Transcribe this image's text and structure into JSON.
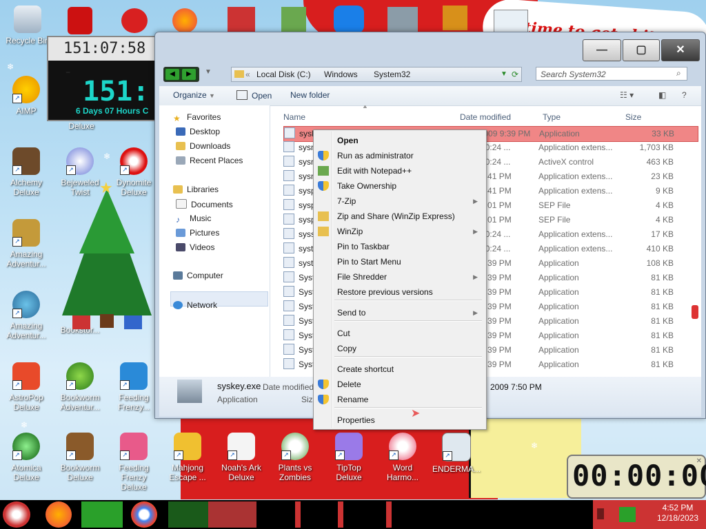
{
  "window": {
    "address": {
      "part1": "Local Disk (C:)",
      "part2": "Windows",
      "part3": "System32"
    },
    "search_placeholder": "Search System32",
    "toolbar": {
      "organize": "Organize",
      "open": "Open",
      "new_folder": "New folder"
    },
    "nav": [
      {
        "label": "Favorites",
        "icon": "star-icon"
      },
      {
        "label": "Desktop",
        "icon": "desktop-icon"
      },
      {
        "label": "Downloads",
        "icon": "downloads-icon"
      },
      {
        "label": "Recent Places",
        "icon": "recent-places-icon"
      },
      {
        "label": "Libraries",
        "icon": "libraries-icon"
      },
      {
        "label": "Documents",
        "icon": "documents-icon"
      },
      {
        "label": "Music",
        "icon": "music-icon"
      },
      {
        "label": "Pictures",
        "icon": "pictures-icon"
      },
      {
        "label": "Videos",
        "icon": "videos-icon"
      },
      {
        "label": "Computer",
        "icon": "computer-icon"
      },
      {
        "label": "Network",
        "icon": "network-icon"
      }
    ],
    "columns": {
      "name": "Name",
      "date": "Date modified",
      "type": "Type",
      "size": "Size"
    },
    "files": [
      {
        "name": "syskey.exe",
        "date": "7/13/2009 9:39 PM",
        "type": "Application",
        "size": "33 KB"
      },
      {
        "name": "sysm",
        "date": "2010 10:24 ...",
        "type": "Application extens...",
        "size": "1,703 KB"
      },
      {
        "name": "sysm",
        "date": "2010 10:24 ...",
        "type": "ActiveX control",
        "size": "463 KB"
      },
      {
        "name": "sysn",
        "date": "2009 9:41 PM",
        "type": "Application extens...",
        "size": "23 KB"
      },
      {
        "name": "sysp",
        "date": "2009 9:41 PM",
        "type": "Application extens...",
        "size": "9 KB"
      },
      {
        "name": "sysp",
        "date": "2009 5:01 PM",
        "type": "SEP File",
        "size": "4 KB"
      },
      {
        "name": "sysp",
        "date": "2009 5:01 PM",
        "type": "SEP File",
        "size": "4 KB"
      },
      {
        "name": "syss",
        "date": "2010 10:24 ...",
        "type": "Application extens...",
        "size": "17 KB"
      },
      {
        "name": "syst",
        "date": "2010 10:24 ...",
        "type": "Application extens...",
        "size": "410 KB"
      },
      {
        "name": "syst",
        "date": "2009 9:39 PM",
        "type": "Application",
        "size": "108 KB"
      },
      {
        "name": "Syst",
        "date": "2009 9:39 PM",
        "type": "Application",
        "size": "81 KB"
      },
      {
        "name": "Syst",
        "date": "2009 9:39 PM",
        "type": "Application",
        "size": "81 KB"
      },
      {
        "name": "Syst",
        "date": "2009 9:39 PM",
        "type": "Application",
        "size": "81 KB"
      },
      {
        "name": "Syst",
        "date": "2009 9:39 PM",
        "type": "Application",
        "size": "81 KB"
      },
      {
        "name": "Syst",
        "date": "2009 9:39 PM",
        "type": "Application",
        "size": "81 KB"
      },
      {
        "name": "Syst",
        "date": "2009 9:39 PM",
        "type": "Application",
        "size": "81 KB"
      },
      {
        "name": "Syst",
        "date": "2009 9:39 PM",
        "type": "Application",
        "size": "81 KB"
      }
    ],
    "details": {
      "filename": "syskey.exe",
      "filetype": "Application",
      "date_label": "Date modified",
      "size_label": "Size",
      "date_value": "2009 7:50 PM"
    }
  },
  "context_menu": [
    {
      "label": "Open",
      "bold": true
    },
    {
      "label": "Run as administrator",
      "icon": "shield-icon"
    },
    {
      "label": "Edit with Notepad++",
      "icon": "notepad-icon"
    },
    {
      "label": "Take Ownership",
      "icon": "shield-icon"
    },
    {
      "label": "7-Zip",
      "submenu": true
    },
    {
      "label": "Zip and Share (WinZip Express)",
      "icon": "winzip-icon"
    },
    {
      "label": "WinZip",
      "icon": "winzip-icon",
      "submenu": true
    },
    {
      "label": "Pin to Taskbar"
    },
    {
      "label": "Pin to Start Menu"
    },
    {
      "label": "File Shredder",
      "submenu": true
    },
    {
      "label": "Restore previous versions"
    },
    {
      "label": "Send to",
      "submenu": true
    },
    {
      "label": "Cut"
    },
    {
      "label": "Copy"
    },
    {
      "label": "Create shortcut"
    },
    {
      "label": "Delete",
      "icon": "shield-icon"
    },
    {
      "label": "Rename",
      "icon": "shield-icon"
    },
    {
      "label": "Properties"
    }
  ],
  "desktop": {
    "icons": [
      {
        "label": "Recycle Bin",
        "icon": "recycle-bin-icon"
      },
      {
        "label": "AIMP",
        "icon": "aimp-icon"
      },
      {
        "label": "Alchemy Deluxe",
        "icon": "alchemy-icon"
      },
      {
        "label": "Bejeweled Twist",
        "icon": "bejeweled-icon"
      },
      {
        "label": "Dynomite Deluxe",
        "icon": "dynomite-icon"
      },
      {
        "label": "Amazing Adventur...",
        "icon": "amazing-adventures-icon"
      },
      {
        "label": "Amazing Adventur...",
        "icon": "amazing-adventures-icon"
      },
      {
        "label": "Bookstor...",
        "icon": "bookstore-icon"
      },
      {
        "label": "AstroPop Deluxe",
        "icon": "astropop-icon"
      },
      {
        "label": "Bookworm Adventur...",
        "icon": "bookworm-icon"
      },
      {
        "label": "Feeding Frenzy...",
        "icon": "feeding-frenzy-icon"
      },
      {
        "label": "Atomica Deluxe",
        "icon": "atomica-icon"
      },
      {
        "label": "Bookworm Deluxe",
        "icon": "bookworm-deluxe-icon"
      },
      {
        "label": "Feeding Frenzy Deluxe",
        "icon": "feeding-frenzy-icon"
      },
      {
        "label": "Mahjong Escape ...",
        "icon": "mahjong-icon"
      },
      {
        "label": "Noah's Ark Deluxe",
        "icon": "noahs-ark-icon"
      },
      {
        "label": "Plants vs Zombies",
        "icon": "plants-zombies-icon"
      },
      {
        "label": "TipTop Deluxe",
        "icon": "tiptop-icon"
      },
      {
        "label": "Word Harmo...",
        "icon": "word-harmony-icon"
      },
      {
        "label": "ENDERMA...",
        "icon": "enderman-icon"
      },
      {
        "label": "Deluxe",
        "icon": ""
      }
    ],
    "sign_text": "time to get shit"
  },
  "gadget": {
    "small_time": "151:07:58 -",
    "big": "151:",
    "sub": "6 Days 07 Hours C"
  },
  "timer": "00:00:00",
  "clock": {
    "time": "4:52 PM",
    "date": "12/18/2023"
  }
}
